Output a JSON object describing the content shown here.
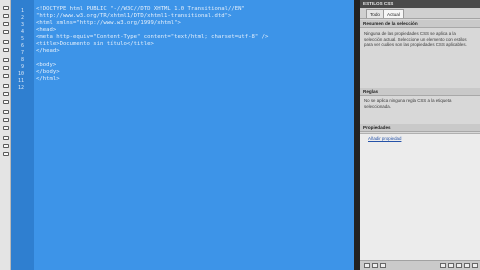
{
  "editor": {
    "line_numbers": [
      "1",
      "2",
      "3",
      "4",
      "5",
      "6",
      "7",
      "8",
      "9",
      "10",
      "11",
      "12"
    ],
    "code_lines": [
      "<!DOCTYPE html PUBLIC \"-//W3C//DTD XHTML 1.0 Transitional//EN\"",
      "\"http://www.w3.org/TR/xhtml1/DTD/xhtml1-transitional.dtd\">",
      "<html xmlns=\"http://www.w3.org/1999/xhtml\">",
      "<head>",
      "<meta http-equiv=\"Content-Type\" content=\"text/html; charset=utf-8\" />",
      "<title>Documento sin título</title>",
      "</head>",
      "",
      "<body>",
      "</body>",
      "</html>",
      ""
    ]
  },
  "css_panel": {
    "title": "ESTILOS CSS",
    "tabs": [
      "Todo",
      "Actual"
    ],
    "active_tab": "Actual",
    "summary_header": "Resumen de la selección",
    "summary_text": "Ninguna de las propiedades CSS se aplica a la selección actual. Seleccione un elemento con estilos para ver cuáles son las propiedades CSS aplicables.",
    "rules_header": "Reglas",
    "rules_text": "No se aplica ninguna regla CSS a la etiqueta seleccionada.",
    "properties_header": "Propiedades",
    "add_property": "Añadir propiedad"
  },
  "bottom_bar": {
    "buttons": [
      "list-view-icon",
      "az-sort-icon",
      "star-view-icon",
      "attach-style-icon",
      "new-rule-icon",
      "edit-rule-icon",
      "disable-icon",
      "delete-icon"
    ]
  },
  "colors": {
    "editor_selection": "#3d94e8",
    "gutter": "#2f7fd0",
    "panel_bg": "#d8d8d8"
  }
}
